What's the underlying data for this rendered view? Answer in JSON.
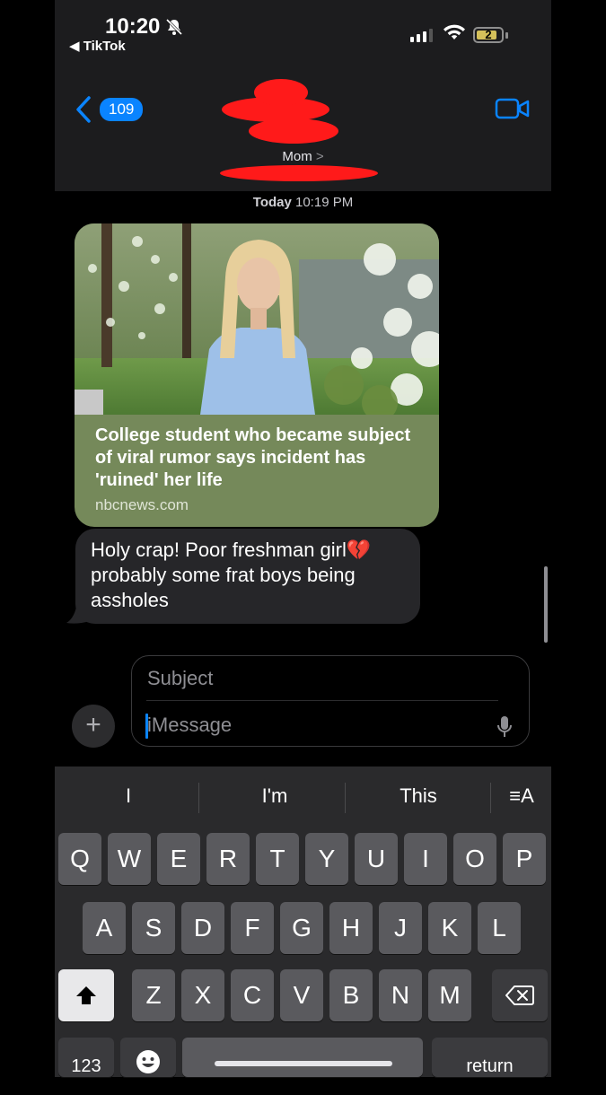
{
  "status_bar": {
    "time": "10:20",
    "back_app": "◀ TikTok",
    "battery": "2"
  },
  "header": {
    "unread_count": "109",
    "contact_name": "Mom",
    "contact_chevron": ">"
  },
  "conversation": {
    "timestamp_day": "Today",
    "timestamp_time": "10:19 PM",
    "link_preview": {
      "title": "College student who became subject of viral rumor says incident has 'ruined' her life",
      "domain": "nbcnews.com"
    },
    "message": {
      "text": "Holy crap! Poor freshman girl",
      "emoji": "💔",
      "text2": "probably some frat boys being assholes"
    }
  },
  "compose": {
    "plus": "+",
    "subject_placeholder": "Subject",
    "message_placeholder": "iMessage"
  },
  "keyboard": {
    "suggestions": [
      "I",
      "I'm",
      "This"
    ],
    "format_label": "≡A",
    "row1": [
      "Q",
      "W",
      "E",
      "R",
      "T",
      "Y",
      "U",
      "I",
      "O",
      "P"
    ],
    "row2": [
      "A",
      "S",
      "D",
      "F",
      "G",
      "H",
      "J",
      "K",
      "L"
    ],
    "row3": [
      "Z",
      "X",
      "C",
      "V",
      "B",
      "N",
      "M"
    ],
    "numbers_label": "123",
    "return_label": "return"
  },
  "colors": {
    "accent": "#0a84ff",
    "link_card": "#75895a",
    "incoming_bubble": "#262629",
    "redaction": "#ff1a1a"
  }
}
